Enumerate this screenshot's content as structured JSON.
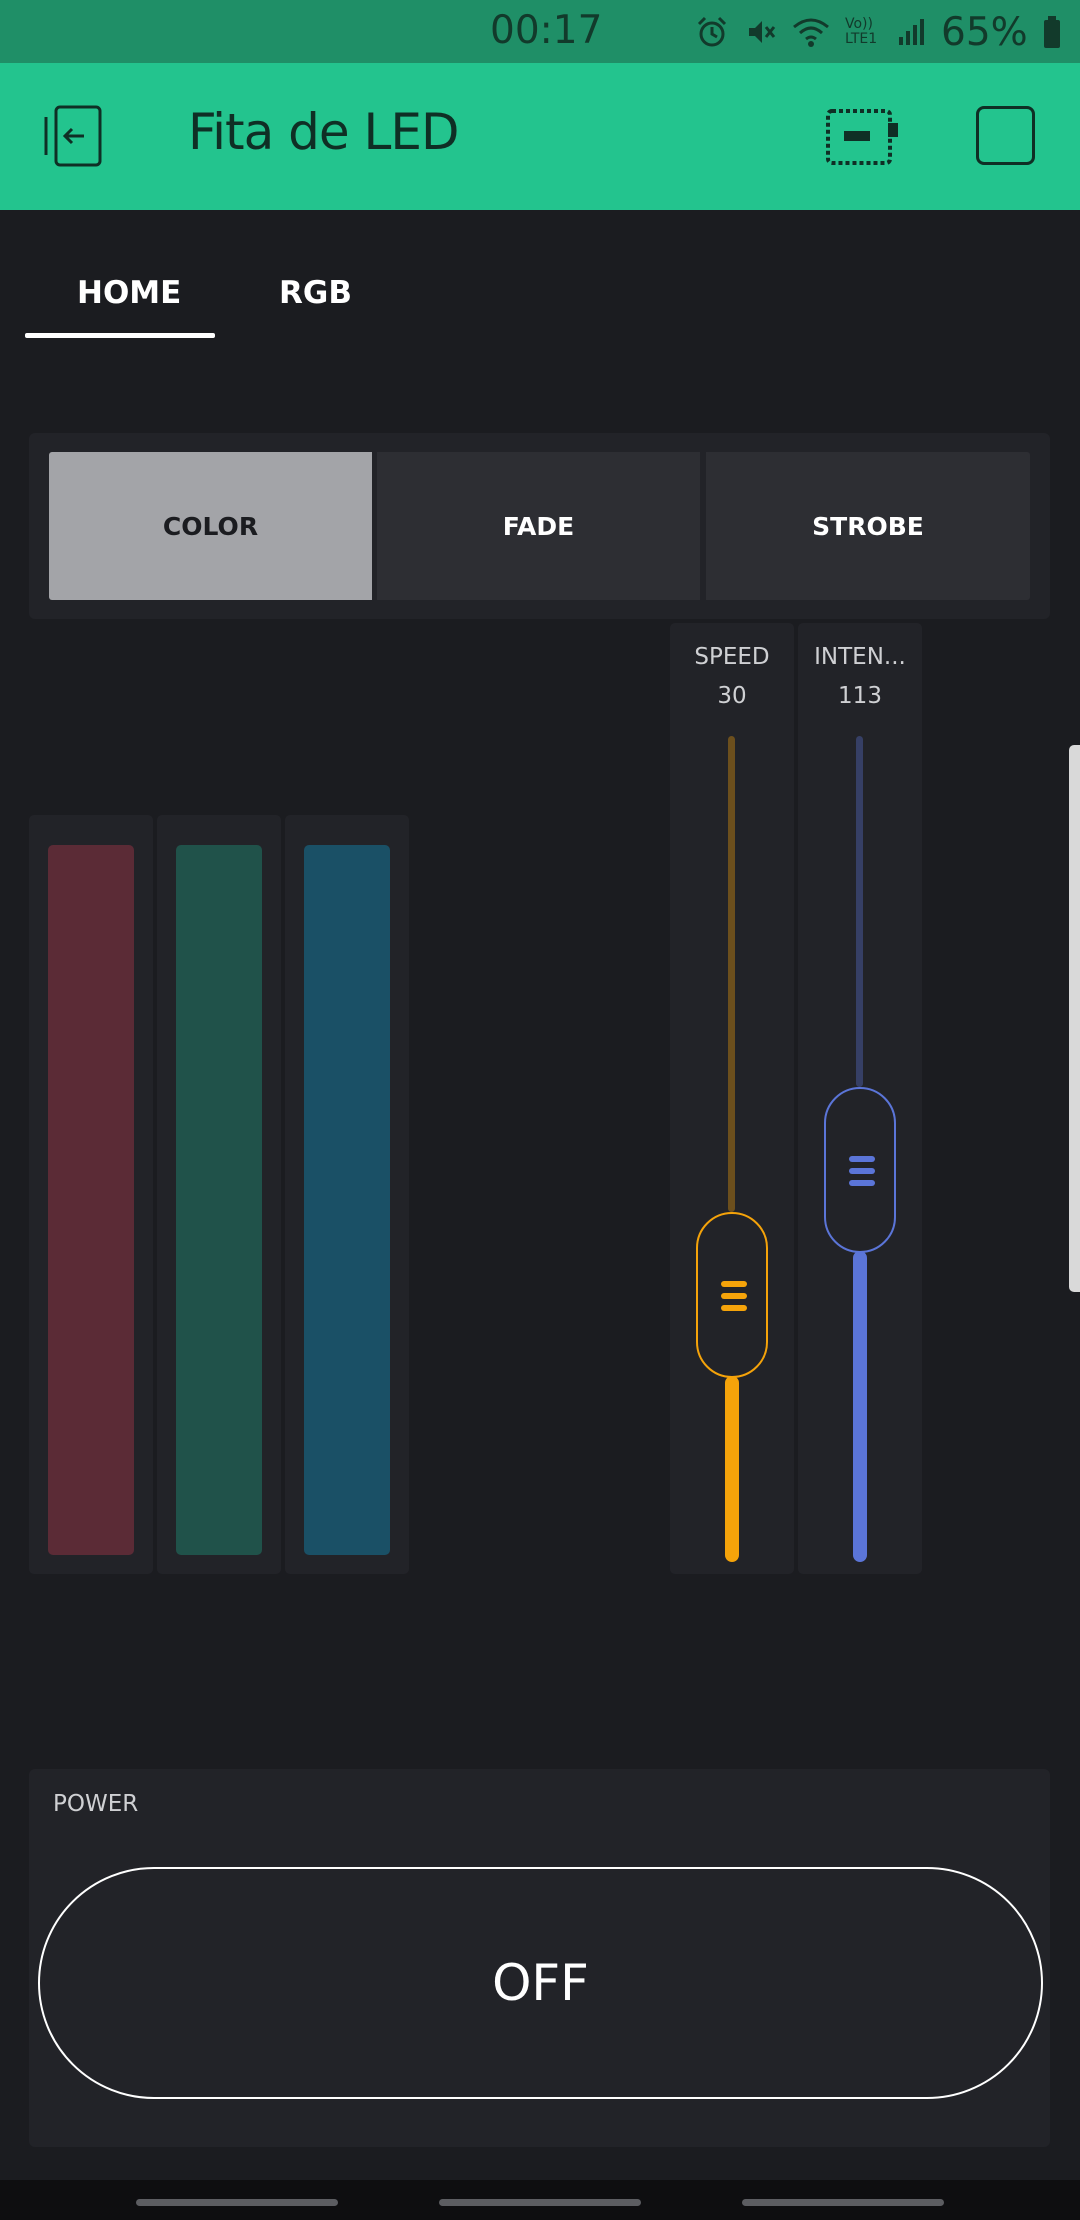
{
  "status_bar": {
    "time": "00:17",
    "battery": "65%",
    "network": "Vo)) LTE1",
    "icons": [
      "alarm-icon",
      "mute-icon",
      "wifi-icon",
      "signal-icon",
      "battery-icon"
    ]
  },
  "header": {
    "title": "Fita de LED",
    "icons": [
      "back-exit-icon",
      "device-icon",
      "square-icon"
    ],
    "color": "#23c48e"
  },
  "tabs": [
    {
      "label": "HOME",
      "selected": true
    },
    {
      "label": "RGB",
      "selected": false
    }
  ],
  "mode_selector": {
    "options": [
      "COLOR",
      "FADE",
      "STROBE"
    ],
    "selected": "COLOR"
  },
  "rgb_bars": [
    {
      "color": "#5b2b36"
    },
    {
      "color": "#20524a"
    },
    {
      "color": "#1a5066"
    }
  ],
  "sliders": [
    {
      "label": "SPEED",
      "value": "30",
      "level": 0.24,
      "color": "#f5a30a"
    },
    {
      "label": "INTEN...",
      "value": "113",
      "level": 0.44,
      "color": "#5b75d8"
    }
  ],
  "power": {
    "label": "POWER",
    "button_label": "OFF"
  }
}
